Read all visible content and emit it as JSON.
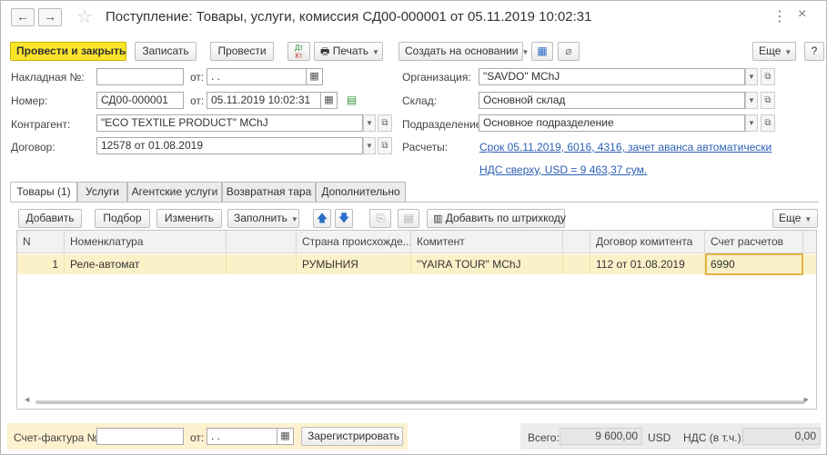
{
  "window": {
    "title": "Поступление: Товары, услуги, комиссия СД00-000001 от 05.11.2019 10:02:31",
    "back_glyph": "←",
    "forward_glyph": "→",
    "star_glyph": "☆",
    "kebab_glyph": "⋮",
    "close_glyph": "×"
  },
  "toolbar": {
    "post_close": "Провести и закрыть",
    "save": "Записать",
    "post": "Провести",
    "dt_kt_top": "Дт",
    "dt_kt_bottom": "Кт",
    "print": "Печать",
    "create_based": "Создать на основании",
    "more": "Еще",
    "help": "?"
  },
  "form": {
    "invoice_label": "Накладная №:",
    "invoice_number": "",
    "from_label": "от:",
    "invoice_date": " .  .",
    "number_label": "Номер:",
    "number": "СД00-000001",
    "date": "05.11.2019 10:02:31",
    "counterparty_label": "Контрагент:",
    "counterparty": "\"ECO TEXTILE PRODUCT\" MChJ",
    "contract_label": "Договор:",
    "contract": "12578 от 01.08.2019",
    "organization_label": "Организация:",
    "organization": "\"SAVDO\" MChJ",
    "warehouse_label": "Склад:",
    "warehouse": "Основной склад",
    "division_label": "Подразделение:",
    "division": "Основное подразделение",
    "settlements_label": "Расчеты:",
    "settlements_link": "Срок 05.11.2019, 6016, 4316, зачет аванса автоматически",
    "vat_link": "НДС сверху, USD = 9 463,37 сум."
  },
  "tabs": [
    {
      "label": "Товары (1)",
      "active": true
    },
    {
      "label": "Услуги",
      "active": false
    },
    {
      "label": "Агентские услуги",
      "active": false
    },
    {
      "label": "Возвратная тара",
      "active": false
    },
    {
      "label": "Дополнительно",
      "active": false
    }
  ],
  "table_toolbar": {
    "add": "Добавить",
    "pick": "Подбор",
    "edit": "Изменить",
    "fill": "Заполнить",
    "add_barcode": "Добавить по штрихкоду",
    "more": "Еще"
  },
  "table": {
    "columns": [
      "N",
      "Номенклатура",
      "",
      "Страна происхожде...",
      "Комитент",
      "",
      "Договор комитента",
      "Счет расчетов"
    ],
    "rows": [
      {
        "n": "1",
        "nomenclature": "Реле-автомат",
        "country": "РУМЫНИЯ",
        "committent": "\"YAIRA TOUR\" MChJ",
        "committent_contract": "112 от 01.08.2019",
        "account": "6990"
      }
    ]
  },
  "footer": {
    "invoice_label": "Счет-фактура №:",
    "invoice_number": "",
    "from_label": "от:",
    "invoice_date": " .  .",
    "register": "Зарегистрировать",
    "total_label": "Всего:",
    "total_value": "9 600,00",
    "currency": "USD",
    "vat_label": "НДС (в т.ч.):",
    "vat_value": "0,00"
  },
  "colors": {
    "primary_button": "#fbe52a",
    "link": "#2b5fb3",
    "selected_row": "#fbf1c9",
    "selected_cell_border": "#e8b24a"
  }
}
